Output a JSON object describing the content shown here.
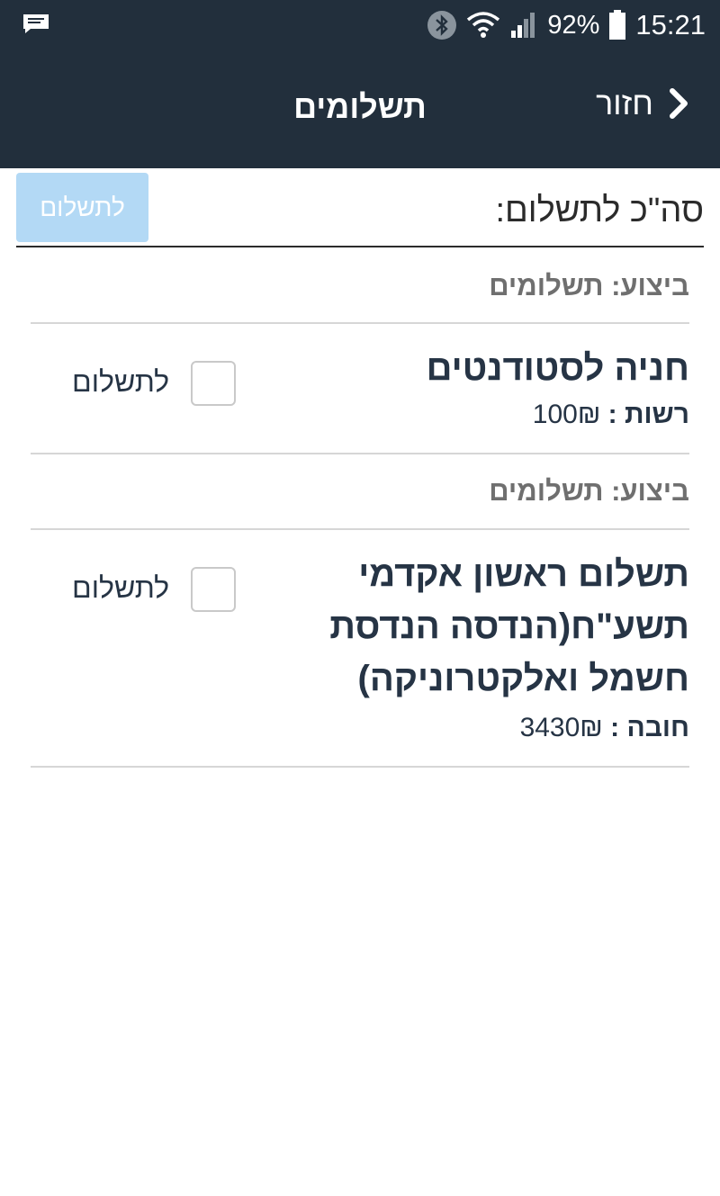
{
  "status_bar": {
    "battery": "92%",
    "time": "15:21",
    "icons": [
      "message-icon",
      "bluetooth-icon",
      "wifi-icon",
      "signal-icon",
      "battery-icon"
    ]
  },
  "app_bar": {
    "title": "תשלומים",
    "back_label": "חזור"
  },
  "summary": {
    "total_label": "סה\"כ לתשלום:",
    "pay_button": "לתשלום"
  },
  "items": [
    {
      "exec_label": "ביצוע: תשלומים",
      "title": "חניה לסטודנטים",
      "amount_label": "רשות :",
      "amount_value": "100₪",
      "checkbox_label": "לתשלום"
    },
    {
      "exec_label": "ביצוע: תשלומים",
      "title_lines": [
        "תשלום ראשון אקדמי",
        "תשע\"ח(הנדסה הנדסת",
        "חשמל ואלקטרוניקה)"
      ],
      "amount_label": "חובה :",
      "amount_value": "3430₪",
      "checkbox_label": "לתשלום"
    }
  ],
  "colors": {
    "header_bg": "#222f3c",
    "button_bg": "#b3d9f5",
    "text_dark": "#263445",
    "text_gray": "#6f6f6f"
  }
}
